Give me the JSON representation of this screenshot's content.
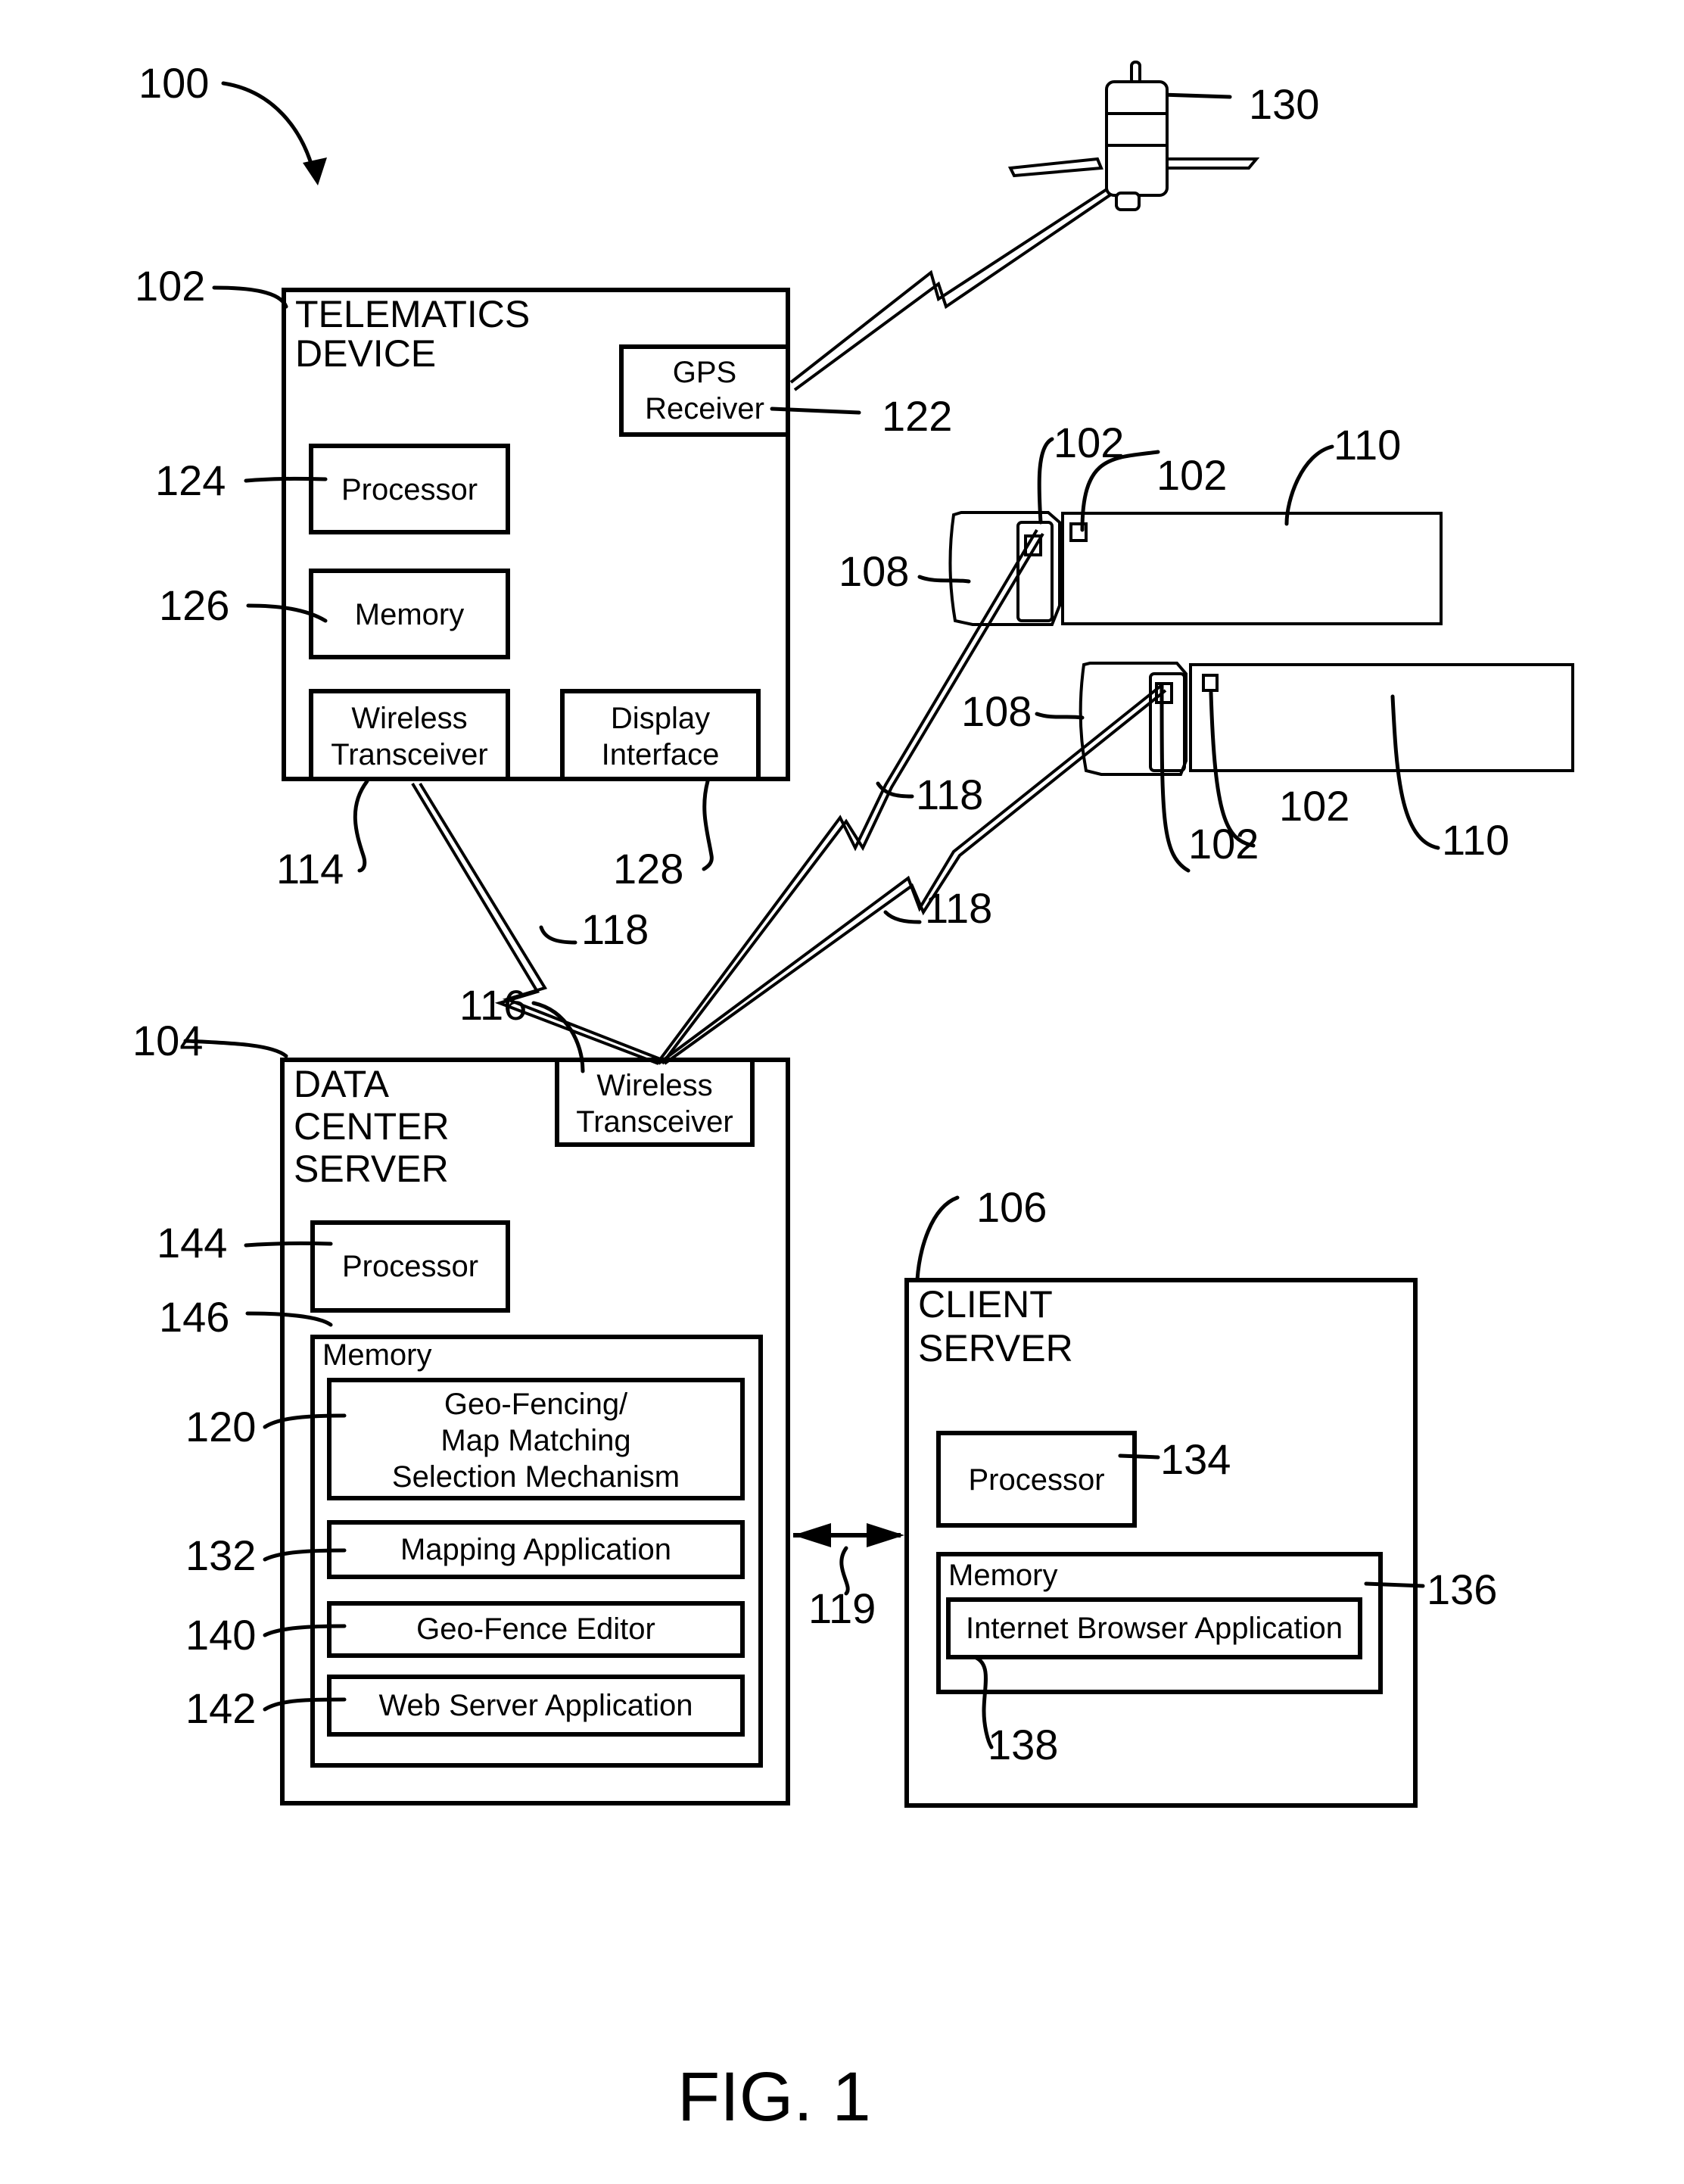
{
  "figure": {
    "system_ref": "100",
    "caption": "FIG. 1"
  },
  "telematics_device": {
    "ref": "102",
    "title_line1": "TELEMATICS",
    "title_line2": "DEVICE",
    "gps_receiver": {
      "ref": "122",
      "line1": "GPS",
      "line2": "Receiver"
    },
    "processor": {
      "ref": "124",
      "label": "Processor"
    },
    "memory": {
      "ref": "126",
      "label": "Memory"
    },
    "wireless_transceiver": {
      "ref": "114",
      "line1": "Wireless",
      "line2": "Transceiver"
    },
    "display_interface": {
      "ref": "128",
      "line1": "Display",
      "line2": "Interface"
    }
  },
  "satellite": {
    "ref": "130"
  },
  "wireless_links": {
    "ref": "118"
  },
  "vehicles": [
    {
      "tractor_ref": "108",
      "trailer_ref": "110",
      "device_refs": [
        "102",
        "102"
      ]
    },
    {
      "tractor_ref": "108",
      "trailer_ref": "110",
      "device_refs": [
        "102",
        "102"
      ]
    }
  ],
  "data_center_server": {
    "ref": "104",
    "title_line1": "DATA",
    "title_line2": "CENTER",
    "title_line3": "SERVER",
    "wireless_transceiver": {
      "ref": "116",
      "line1": "Wireless",
      "line2": "Transceiver"
    },
    "processor": {
      "ref": "144",
      "label": "Processor"
    },
    "memory": {
      "ref": "146",
      "label": "Memory",
      "modules": [
        {
          "ref": "120",
          "line1": "Geo-Fencing/",
          "line2": "Map Matching",
          "line3": "Selection Mechanism"
        },
        {
          "ref": "132",
          "label": "Mapping Application"
        },
        {
          "ref": "140",
          "label": "Geo-Fence Editor"
        },
        {
          "ref": "142",
          "label": "Web Server Application"
        }
      ]
    }
  },
  "connection": {
    "ref": "119"
  },
  "client_server": {
    "ref": "106",
    "title_line1": "CLIENT",
    "title_line2": "SERVER",
    "processor": {
      "ref": "134",
      "label": "Processor"
    },
    "memory": {
      "ref": "136",
      "label": "Memory",
      "browser": {
        "ref": "138",
        "label": "Internet Browser Application"
      }
    }
  }
}
